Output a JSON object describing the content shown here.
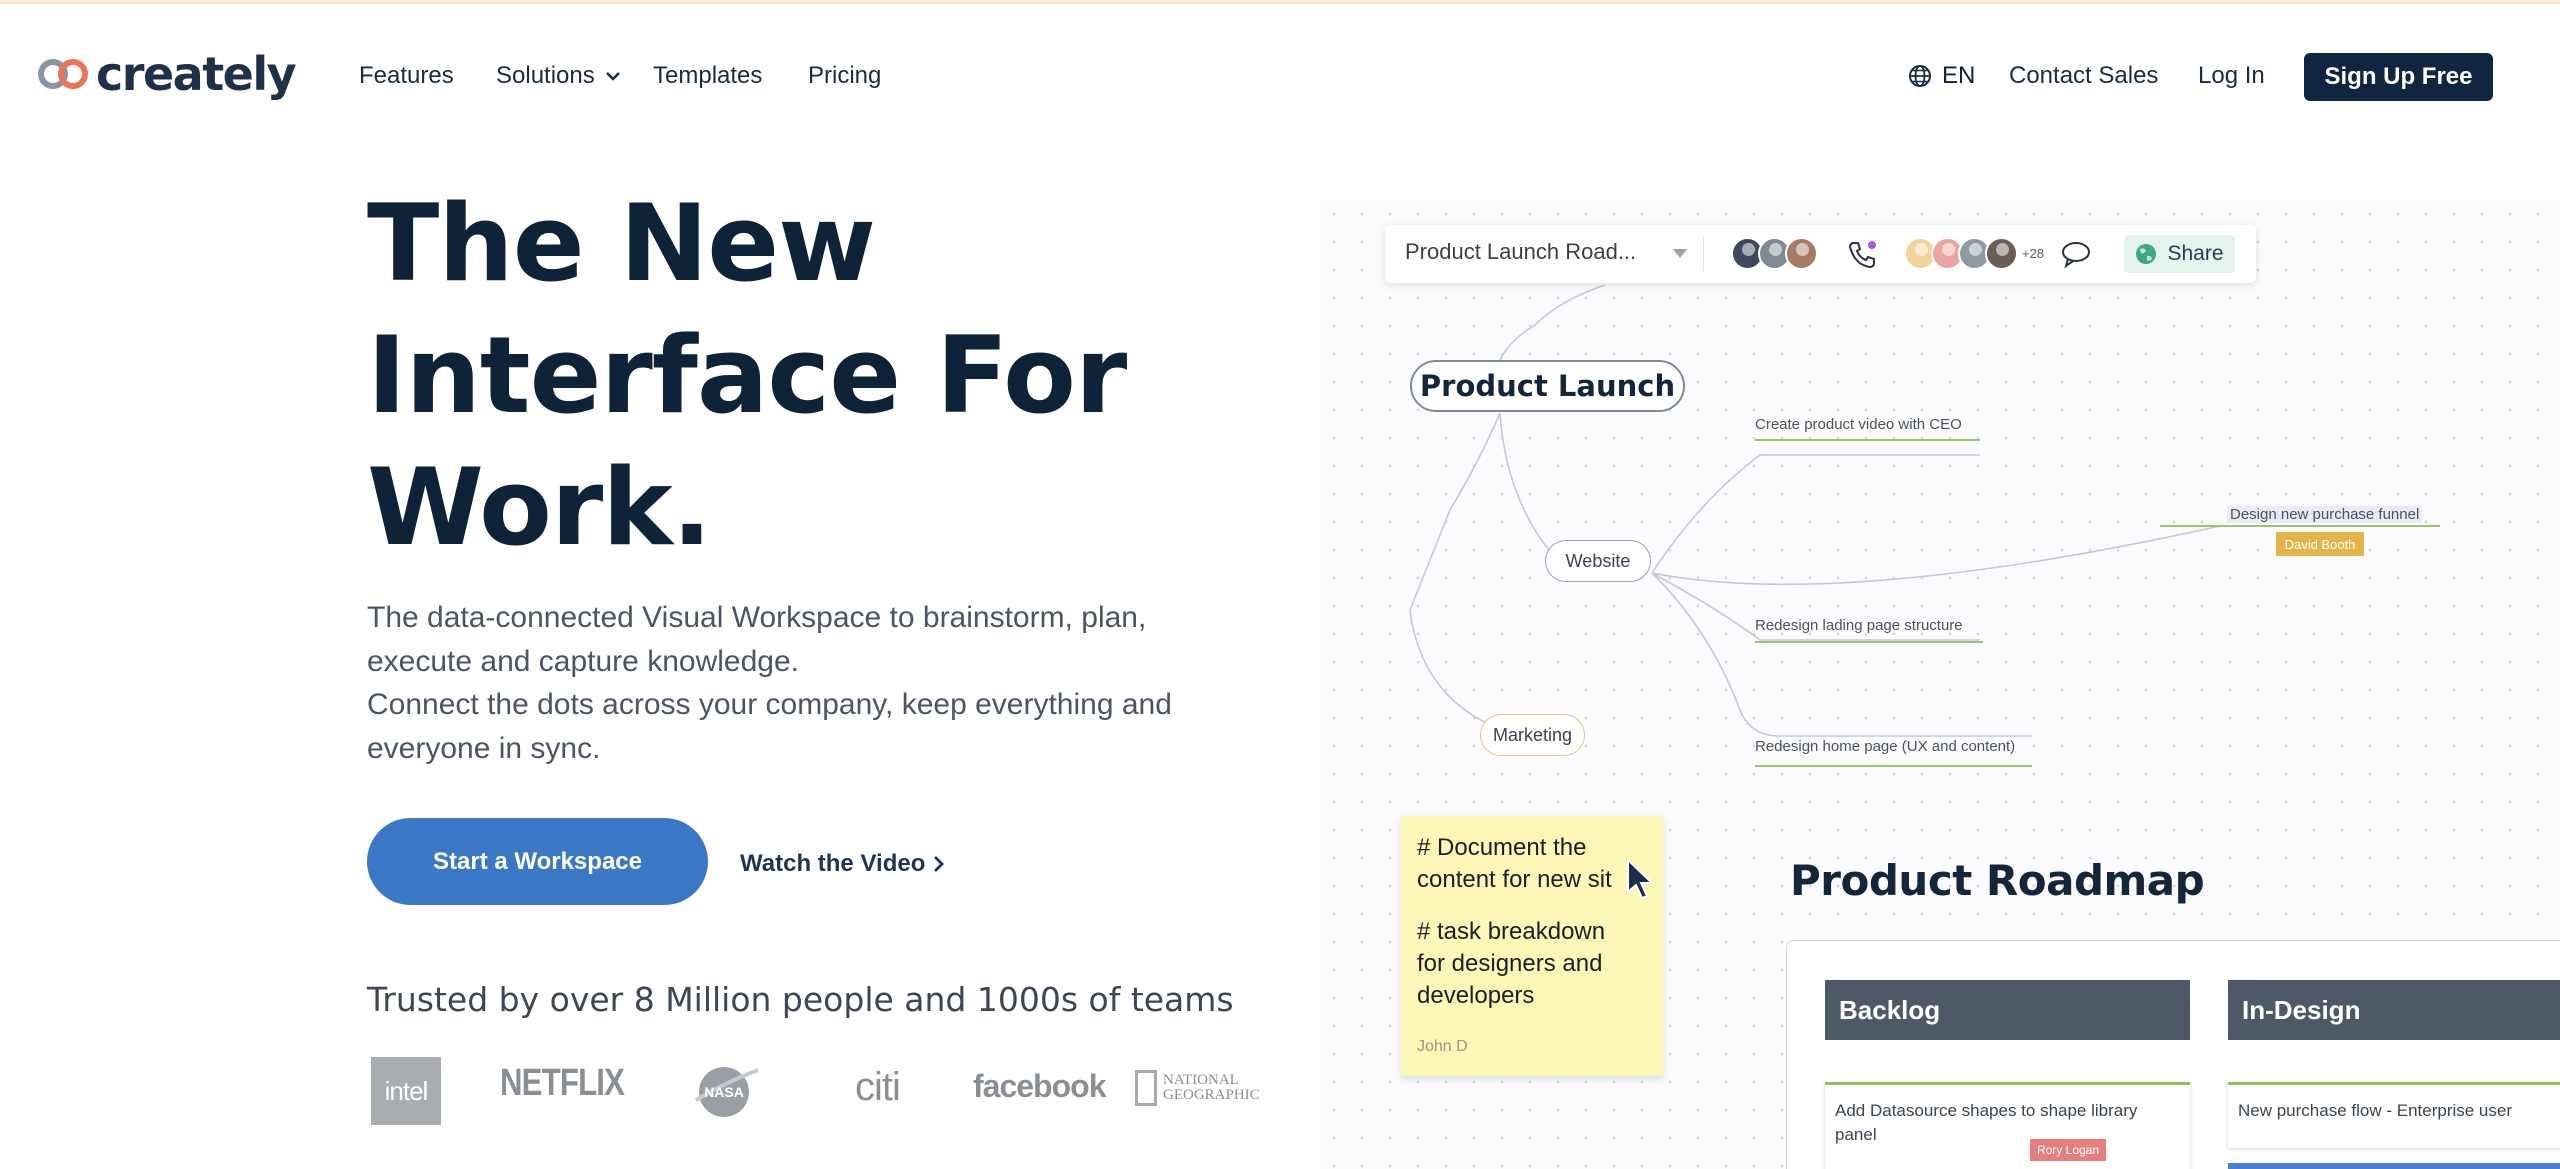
{
  "brand": {
    "name": "creately"
  },
  "nav": {
    "features": "Features",
    "solutions": "Solutions",
    "templates": "Templates",
    "pricing": "Pricing",
    "language": "EN",
    "contact_sales": "Contact Sales",
    "login": "Log In",
    "signup": "Sign Up Free"
  },
  "hero": {
    "title_lines": [
      "The New",
      "Interface For",
      "Work."
    ],
    "description_lines": [
      "The data-connected Visual Workspace to brainstorm, plan,",
      "execute and capture knowledge.",
      "Connect the dots across your company, keep everything and",
      "everyone in sync."
    ],
    "cta_primary": "Start a Workspace",
    "cta_secondary": "Watch the Video",
    "trusted": "Trusted by over 8 Million people and 1000s of teams"
  },
  "trusted_logos": {
    "intel": "intel",
    "netflix": "NETFLIX",
    "nasa": "NASA",
    "citi": "citi",
    "facebook": "facebook",
    "natgeo_lines": [
      "NATIONAL",
      "GEOGRAPHIC"
    ]
  },
  "canvas_preview": {
    "toolbar": {
      "document_title": "Product Launch Road...",
      "more_collaborators": "+28",
      "share": "Share"
    },
    "mindmap": {
      "root": "Product Launch",
      "website": "Website",
      "marketing": "Marketing",
      "leaves": [
        "Create product video with CEO",
        "Design new purchase funnel",
        "Redesign lading page structure",
        "Redesign home page (UX and content)"
      ],
      "assignee_tag": "David Booth"
    },
    "sticky_note": {
      "lines": [
        "# Document the",
        "content for new sit",
        "# task breakdown",
        "for designers and",
        "developers"
      ],
      "author": "John D"
    },
    "roadmap": {
      "title": "Product Roadmap",
      "columns": [
        "Backlog",
        "In-Design"
      ],
      "cards": [
        "Add Datasource shapes to shape library panel",
        "New purchase flow - Enterprise user"
      ],
      "card_tag": "Rory Logan"
    }
  },
  "colors": {
    "navy": "#0f2540",
    "primary_blue": "#3a78c6",
    "logo_orange": "#e8765a",
    "tag_yellow": "#e4b44a",
    "tag_red": "#e67e7e",
    "sticky_yellow": "#fdf7b7",
    "column_header": "#4f5866"
  },
  "icons": [
    "creately-logo-icon",
    "chevron-down-icon",
    "globe-icon",
    "chevron-right-icon",
    "phone-icon",
    "comment-icon",
    "earth-icon",
    "mouse-cursor-icon"
  ]
}
